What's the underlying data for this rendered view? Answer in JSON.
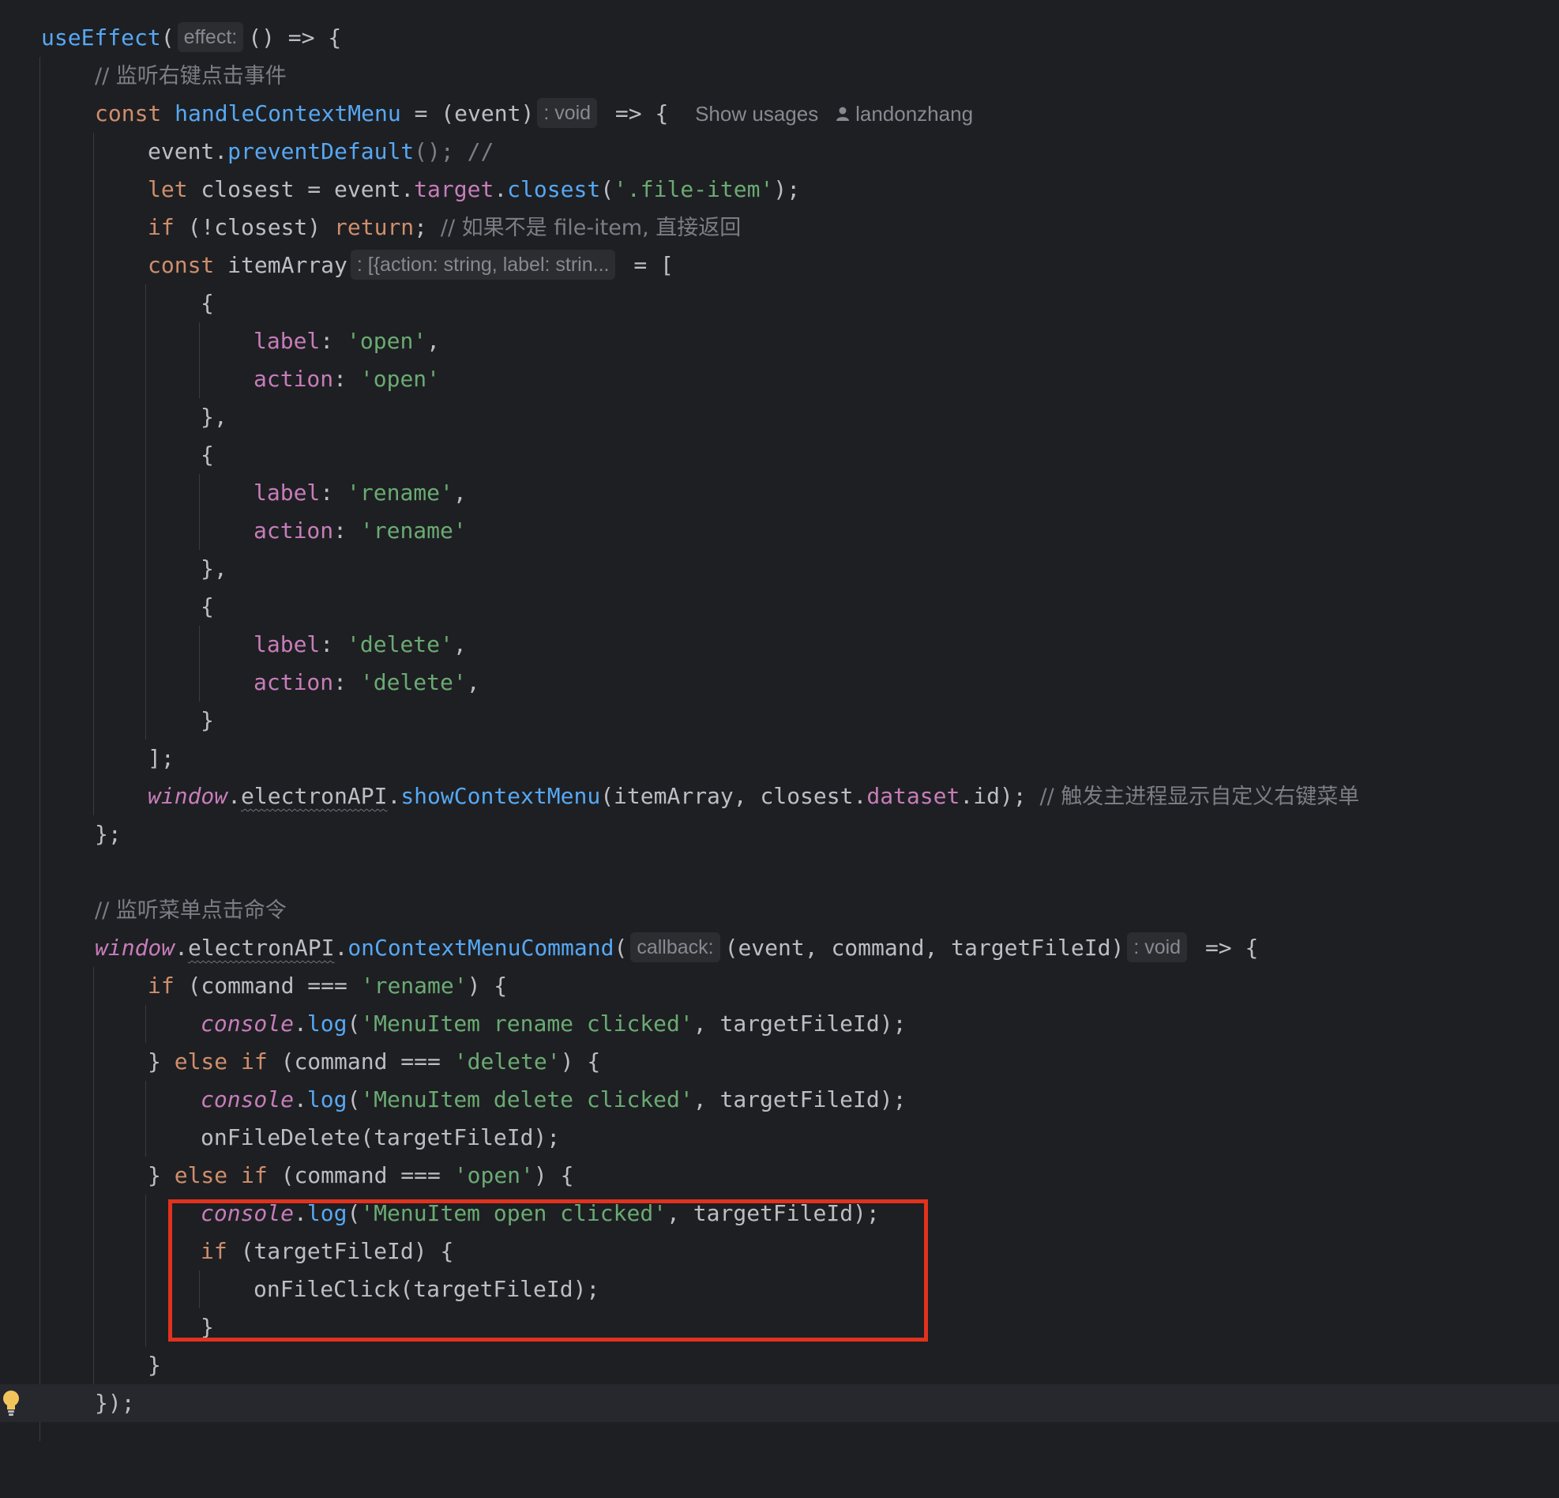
{
  "colors": {
    "background": "#1e1f22",
    "current_line": "#26282e",
    "function": "#56a8f5",
    "keyword": "#cf8e6d",
    "string": "#6aab73",
    "property": "#c77dbb",
    "comment": "#7a7e85",
    "text": "#bcbec4",
    "highlight_box": "#e1321e"
  },
  "icons": {
    "user": "user-icon",
    "bulb": "lightbulb-icon"
  },
  "code": {
    "l1": {
      "fn": "useEffect",
      "open": "(",
      "hint": "effect:",
      "rest": "() => {"
    },
    "l2": {
      "comment": "// 监听右键点击事件"
    },
    "l3": {
      "kw": "const",
      "fn": "handleContextMenu",
      "rest": " = (event)",
      "hint": ": void",
      "arrow": " => {",
      "usages": "Show usages",
      "author": "landonzhang"
    },
    "l4": {
      "a": "event.",
      "fn": "preventDefault",
      "b": "(); //"
    },
    "l5": {
      "kw": "let",
      "a": " closest = event.",
      "prop": "target",
      "dot": ".",
      "fn": "closest",
      "open": "(",
      "str": "'.file-item'",
      "close": ");"
    },
    "l6": {
      "kw": "if",
      "a": " (!closest) ",
      "kw2": "return",
      "b": "; ",
      "comment": "// 如果不是 file-item, 直接返回"
    },
    "l7": {
      "kw": "const",
      "a": " itemArray",
      "hint": ": [{action: string, label: strin...",
      "b": " = ["
    },
    "l8": {
      "a": "{"
    },
    "l9": {
      "prop": "label",
      "a": ": ",
      "str": "'open'",
      "b": ","
    },
    "l10": {
      "prop": "action",
      "a": ": ",
      "str": "'open'"
    },
    "l11": {
      "a": "},"
    },
    "l12": {
      "a": "{"
    },
    "l13": {
      "prop": "label",
      "a": ": ",
      "str": "'rename'",
      "b": ","
    },
    "l14": {
      "prop": "action",
      "a": ": ",
      "str": "'rename'"
    },
    "l15": {
      "a": "},"
    },
    "l16": {
      "a": "{"
    },
    "l17": {
      "prop": "label",
      "a": ": ",
      "str": "'delete'",
      "b": ","
    },
    "l18": {
      "prop": "action",
      "a": ": ",
      "str": "'delete'",
      "b": ","
    },
    "l19": {
      "a": "}"
    },
    "l20": {
      "a": "];"
    },
    "l21": {
      "gl": "window",
      "dot": ".",
      "api": "electronAPI",
      "dot2": ".",
      "fn": "showContextMenu",
      "a": "(itemArray, closest.",
      "prop": "dataset",
      "b": ".id); ",
      "comment": "// 触发主进程显示自定义右键菜单"
    },
    "l22": {
      "a": "};"
    },
    "l24": {
      "comment": "// 监听菜单点击命令"
    },
    "l25": {
      "gl": "window",
      "dot": ".",
      "api": "electronAPI",
      "dot2": ".",
      "fn": "onContextMenuCommand",
      "open": "(",
      "hint": "callback:",
      "a": "(event, command, targetFileId)",
      "hint2": ": void",
      "b": " => {"
    },
    "l26": {
      "kw": "if",
      "a": " (command === ",
      "str": "'rename'",
      "b": ") {"
    },
    "l27": {
      "gl": "console",
      "dot": ".",
      "fn": "log",
      "open": "(",
      "str": "'MenuItem rename clicked'",
      "a": ", targetFileId);"
    },
    "l28": {
      "a": "} ",
      "kw": "else if",
      "b": " (command === ",
      "str": "'delete'",
      "c": ") {"
    },
    "l29": {
      "gl": "console",
      "dot": ".",
      "fn": "log",
      "open": "(",
      "str": "'MenuItem delete clicked'",
      "a": ", targetFileId);"
    },
    "l30": {
      "a": "onFileDelete(targetFileId);"
    },
    "l31": {
      "a": "} ",
      "kw": "else if",
      "b": " (command === ",
      "str": "'open'",
      "c": ") {"
    },
    "l32": {
      "gl": "console",
      "dot": ".",
      "fn": "log",
      "open": "(",
      "str": "'MenuItem open clicked'",
      "a": ", targetFileId);"
    },
    "l33": {
      "kw": "if",
      "a": " (targetFileId) {"
    },
    "l34": {
      "a": "onFileClick(targetFileId);"
    },
    "l35": {
      "a": "}"
    },
    "l36": {
      "a": "}"
    },
    "l37": {
      "a": "});"
    }
  }
}
